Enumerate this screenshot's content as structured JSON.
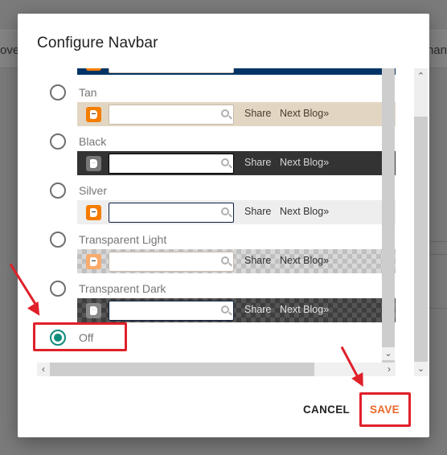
{
  "backdrop": {
    "left_text": "ove",
    "right_text": "han"
  },
  "dialog": {
    "title": "Configure Navbar",
    "options": [
      {
        "label": "Tan",
        "theme": "tan",
        "selected": false
      },
      {
        "label": "Black",
        "theme": "black",
        "selected": false
      },
      {
        "label": "Silver",
        "theme": "silver",
        "selected": false
      },
      {
        "label": "Transparent Light",
        "theme": "transparent-light",
        "selected": false
      },
      {
        "label": "Transparent Dark",
        "theme": "transparent-dark",
        "selected": false
      },
      {
        "label": "Off",
        "theme": "off",
        "selected": true
      }
    ],
    "navbar_preview": {
      "share_label": "Share",
      "next_blog_label": "Next Blog»",
      "logo_icon": "blogger-icon",
      "search_icon": "search-icon"
    },
    "cancel_label": "CANCEL",
    "save_label": "SAVE"
  },
  "colors": {
    "accent_radio": "#0f8c7b",
    "save_text": "#e8692b",
    "annotation_red": "#e0202a",
    "blogger_orange": "#f57d00"
  }
}
